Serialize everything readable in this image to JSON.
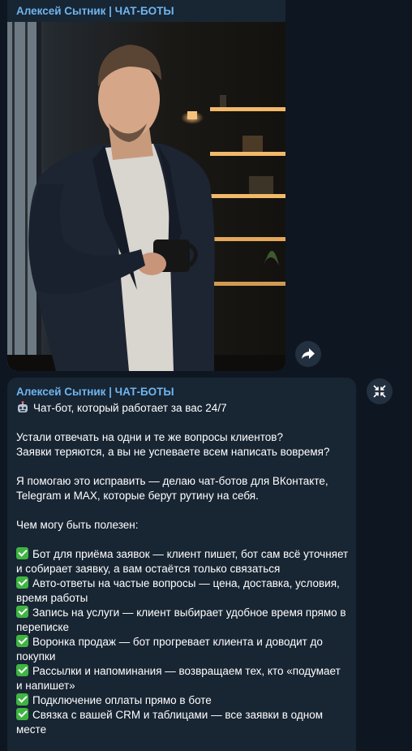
{
  "post1": {
    "sender": "Алексей Сытник | ЧАТ-БОТЫ"
  },
  "post2": {
    "sender": "Алексей Сытник | ЧАТ-БОТЫ",
    "headline": "Чат-бот, который работает за вас 24/7",
    "para1": [
      "Устали отвечать на одни и те же вопросы клиентов?",
      "Заявки теряются, а вы не успеваете всем написать вовремя?"
    ],
    "para2": [
      "Я помогаю это исправить — делаю чат-ботов для ВКонтакте,",
      "Telegram и MAX, которые берут рутину на себя."
    ],
    "section_title": "Чем могу быть полезен:",
    "features": [
      [
        "Бот для приёма заявок — клиент пишет, бот сам всё уточняет",
        "и собирает заявку, а вам остаётся только связаться"
      ],
      [
        "Авто-ответы на частые вопросы — цена, доставка, условия,",
        "время работы"
      ],
      [
        "Запись на услуги — клиент выбирает удобное время прямо в",
        "переписке"
      ],
      [
        "Воронка продаж — бот прогревает клиента и доводит до",
        "покупки"
      ],
      [
        "Рассылки и напоминания — возвращаем тех, кто «подумает",
        "и напишет»"
      ],
      [
        "Подключение оплаты прямо в боте"
      ],
      [
        "Связка с вашей CRM и таблицами — все заявки в одном",
        "месте"
      ]
    ]
  },
  "icons": {
    "forward": "forward-arrow-icon",
    "collapse": "collapse-icon",
    "robot": "robot-emoji-icon",
    "check": "check-mark-emoji-icon"
  },
  "colors": {
    "background": "#0e1621",
    "bubble": "#182533",
    "sender_name": "#6fb5ef",
    "check_green": "#3fb443"
  }
}
